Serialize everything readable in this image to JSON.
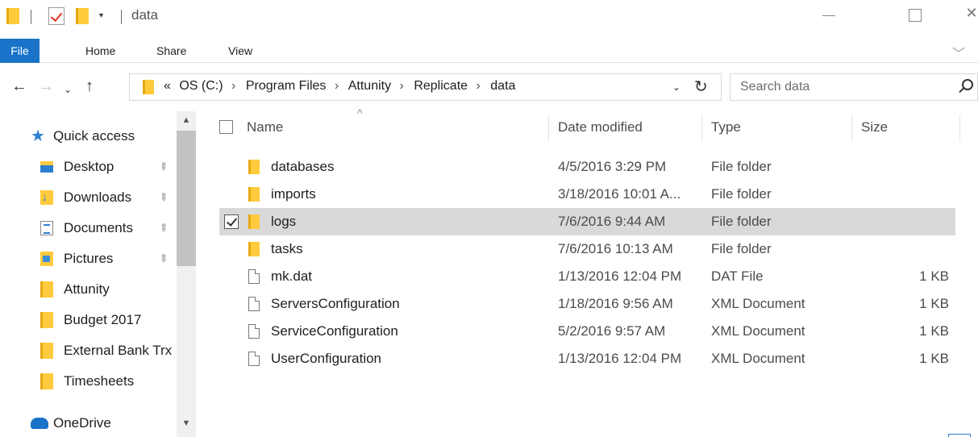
{
  "window": {
    "title": "data",
    "qa_dropdown": "▾",
    "close_glyph": "✕"
  },
  "ribbon": {
    "tabs": [
      "File",
      "Home",
      "Share",
      "View"
    ],
    "collapse_glyph": "﹀"
  },
  "address": {
    "overflow": "«",
    "crumbs": [
      "OS (C:)",
      "Program Files",
      "Attunity",
      "Replicate",
      "data"
    ],
    "separator": "›",
    "refresh_glyph": "↻",
    "dropdown_glyph": "⌄"
  },
  "search": {
    "placeholder": "Search data"
  },
  "nav_buttons": {
    "back": "←",
    "forward": "→",
    "recent": "⌄",
    "up": "↑"
  },
  "navpane": {
    "items": [
      {
        "label": "Quick access",
        "icon": "quick-access-star-icon",
        "pinned": false
      },
      {
        "label": "Desktop",
        "icon": "desktop-icon",
        "pinned": true
      },
      {
        "label": "Downloads",
        "icon": "downloads-icon",
        "pinned": true
      },
      {
        "label": "Documents",
        "icon": "documents-icon",
        "pinned": true
      },
      {
        "label": "Pictures",
        "icon": "pictures-icon",
        "pinned": true
      },
      {
        "label": "Attunity",
        "icon": "folder-icon",
        "pinned": false
      },
      {
        "label": "Budget 2017",
        "icon": "folder-icon",
        "pinned": false
      },
      {
        "label": "External Bank Trx",
        "icon": "folder-icon",
        "pinned": false
      },
      {
        "label": "Timesheets",
        "icon": "folder-icon",
        "pinned": false
      },
      {
        "label": "OneDrive",
        "icon": "onedrive-icon",
        "pinned": false
      }
    ],
    "pin_glyph": "📌"
  },
  "columns": {
    "name": "Name",
    "date": "Date modified",
    "type": "Type",
    "size": "Size"
  },
  "files": [
    {
      "name": "databases",
      "date": "4/5/2016 3:29 PM",
      "type": "File folder",
      "size": "",
      "kind": "folder",
      "selected": false
    },
    {
      "name": "imports",
      "date": "3/18/2016 10:01 A...",
      "type": "File folder",
      "size": "",
      "kind": "folder",
      "selected": false
    },
    {
      "name": "logs",
      "date": "7/6/2016 9:44 AM",
      "type": "File folder",
      "size": "",
      "kind": "folder",
      "selected": true
    },
    {
      "name": "tasks",
      "date": "7/6/2016 10:13 AM",
      "type": "File folder",
      "size": "",
      "kind": "folder",
      "selected": false
    },
    {
      "name": "mk.dat",
      "date": "1/13/2016 12:04 PM",
      "type": "DAT File",
      "size": "1 KB",
      "kind": "file",
      "selected": false
    },
    {
      "name": "ServersConfiguration",
      "date": "1/18/2016 9:56 AM",
      "type": "XML Document",
      "size": "1 KB",
      "kind": "file",
      "selected": false
    },
    {
      "name": "ServiceConfiguration",
      "date": "5/2/2016 9:57 AM",
      "type": "XML Document",
      "size": "1 KB",
      "kind": "file",
      "selected": false
    },
    {
      "name": "UserConfiguration",
      "date": "1/13/2016 12:04 PM",
      "type": "XML Document",
      "size": "1 KB",
      "kind": "file",
      "selected": false
    }
  ],
  "colors": {
    "accent": "#1a73c8",
    "folder": "#ffcb3d",
    "selection": "#d9d9d9"
  }
}
